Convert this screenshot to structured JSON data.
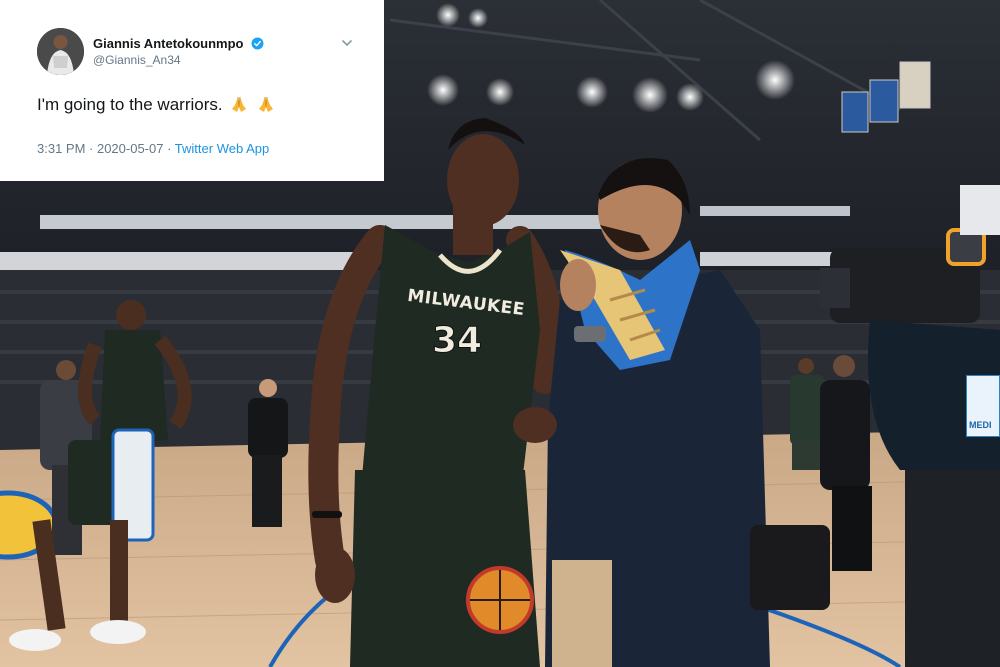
{
  "tweet": {
    "display_name": "Giannis Antetokounmpo",
    "handle": "@Giannis_An34",
    "text": "I'm going to the warriors.",
    "timestamp": "3:31 PM · 2020-05-07 ·",
    "source": "Twitter Web App",
    "verified": true,
    "emoji": [
      "folded-hands",
      "folded-hands"
    ]
  },
  "photo": {
    "jersey_wordmark": "MILWAUKEE",
    "jersey_number": "34",
    "badge_text": "MEDI",
    "colors": {
      "bucks_green": "#1f2a22",
      "warriors_blue": "#1d64b8",
      "court_wood": "#d9b895",
      "twitter_blue": "#1b95e0"
    }
  }
}
